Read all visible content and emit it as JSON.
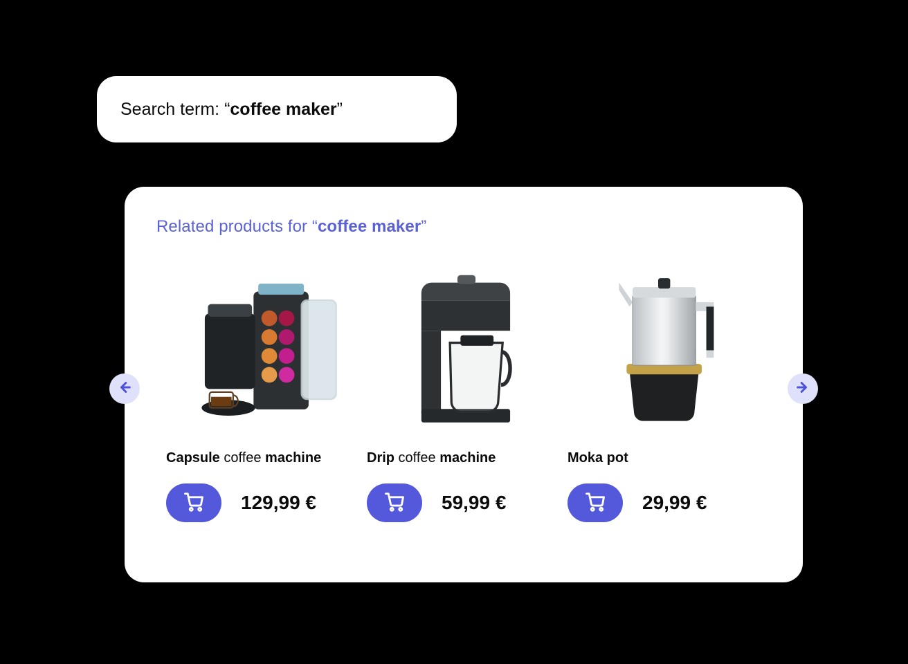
{
  "search": {
    "label_prefix": "Search term: ",
    "open_quote": "“",
    "close_quote": "”",
    "term": "coffee maker"
  },
  "related": {
    "label_prefix": "Related products for ",
    "open_quote": "“",
    "close_quote": "”",
    "term": "coffee maker"
  },
  "nav": {
    "prev_icon": "arrow-left-icon",
    "next_icon": "arrow-right-icon"
  },
  "products": [
    {
      "title_parts": [
        {
          "text": "Capsule",
          "bold": true
        },
        {
          "text": " coffee ",
          "bold": false
        },
        {
          "text": "machine",
          "bold": true
        }
      ],
      "price": "129,99 €",
      "cart_icon": "cart-icon",
      "image_icon": "capsule-coffee-machine-image"
    },
    {
      "title_parts": [
        {
          "text": "Drip",
          "bold": true
        },
        {
          "text": " coffee ",
          "bold": false
        },
        {
          "text": "machine",
          "bold": true
        }
      ],
      "price": "59,99 €",
      "cart_icon": "cart-icon",
      "image_icon": "drip-coffee-machine-image"
    },
    {
      "title_parts": [
        {
          "text": "Moka pot",
          "bold": true
        }
      ],
      "price": "29,99 €",
      "cart_icon": "cart-icon",
      "image_icon": "moka-pot-image"
    }
  ],
  "colors": {
    "accent": "#5459dc",
    "accent_light": "#dfe1fb",
    "panel_bg": "#ffffff",
    "page_bg": "#000000",
    "text": "#0b0b0c"
  }
}
